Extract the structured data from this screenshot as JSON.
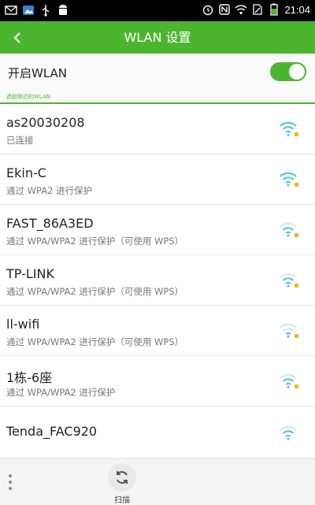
{
  "status_bar": {
    "time": "21:04"
  },
  "header": {
    "title": "WLAN 设置",
    "back_icon": "back-arrow-icon"
  },
  "wlan_toggle": {
    "label": "开启WLAN",
    "enabled": true
  },
  "section": {
    "label": "选取附近的WLAN"
  },
  "networks": [
    {
      "name": "as20030208",
      "status": "已连接",
      "secured": true
    },
    {
      "name": "Ekin-C",
      "status": "通过 WPA2 进行保护",
      "secured": true
    },
    {
      "name": "FAST_86A3ED",
      "status": "通过 WPA/WPA2 进行保护（可使用 WPS）",
      "secured": true
    },
    {
      "name": "TP-LINK",
      "status": "通过 WPA/WPA2 进行保护（可使用 WPS）",
      "secured": true
    },
    {
      "name": "ll-wifi",
      "status": "通过 WPA/WPA2 进行保护（可使用 WPS）",
      "secured": true
    },
    {
      "name": "1栋-6座",
      "status": "通过 WPA/WPA2 进行保护",
      "secured": true
    },
    {
      "name": "Tenda_FAC920",
      "status": "",
      "secured": false
    }
  ],
  "bottom_bar": {
    "scan_label": "扫描"
  },
  "colors": {
    "accent": "#4cb52f",
    "wifi": "#4cc3d8",
    "lock": "#f2b51f"
  }
}
